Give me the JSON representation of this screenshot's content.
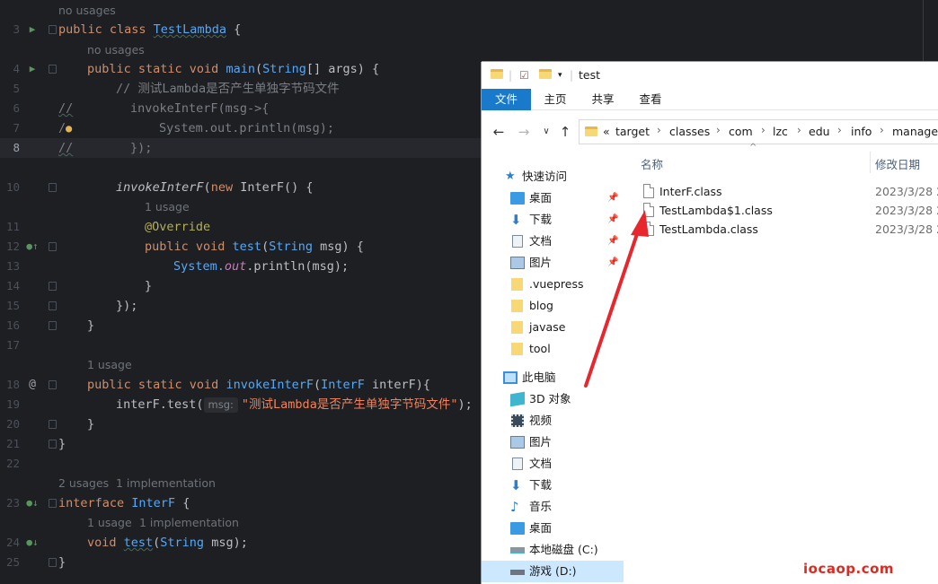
{
  "editor": {
    "usage_hints": {
      "class_usages": "no usages",
      "main_usages": "no usages",
      "override_usages": "1 usage",
      "invoke_usages": "1 usage",
      "interf_usages": "2 usages",
      "interf_impl": "1 implementation",
      "test_usages": "1 usage",
      "test_impl": "1 implementation"
    },
    "line_numbers": [
      "3",
      "4",
      "5",
      "6",
      "7",
      "8",
      "10",
      "11",
      "12",
      "13",
      "14",
      "15",
      "16",
      "17",
      "18",
      "19",
      "20",
      "21",
      "22",
      "23",
      "24",
      "25"
    ],
    "code": {
      "l3_kw": "public class ",
      "l3_name": "TestLambda",
      "l3_rest": " {",
      "l4_kw": "public static void ",
      "l4_fn": "main",
      "l4_p1": "(",
      "l4_type": "String",
      "l4_rest": "[] args) {",
      "l5_comment": "// 测试Lambda是否产生单独字节码文件",
      "l6_slash": "//",
      "l6_code": "invokeInterF(msg->{",
      "l7_slash": "/",
      "l7_code": "System.out.println(msg);",
      "l8_slash": "//",
      "l8_code": "});",
      "l10_fn": "invokeInterF",
      "l10_p": "(",
      "l10_kw": "new ",
      "l10_type": "InterF",
      "l10_rest": "() {",
      "l11_ann": "@Override",
      "l12_kw": "public void ",
      "l12_fn": "test",
      "l12_p": "(",
      "l12_type": "String",
      "l12_rest": " msg) {",
      "l13_sys": "System.",
      "l13_out": "out",
      "l13_rest": ".println(msg);",
      "l14": "}",
      "l15": "});",
      "l16": "}",
      "l18_kw": "public static void ",
      "l18_fn": "invokeInterF",
      "l18_p": "(",
      "l18_type": "InterF",
      "l18_rest": " interF){",
      "l19_pre": "interF.test(",
      "l19_hint": "msg:",
      "l19_str": "\"测试Lambda是否产生单独字节码文件\"",
      "l19_rest": ");",
      "l20": "}",
      "l21": "}",
      "l23_kw": "interface ",
      "l23_type": "InterF",
      "l23_rest": " {",
      "l24_kw": "void ",
      "l24_fn": "test",
      "l24_p": "(",
      "l24_type": "String",
      "l24_rest": " msg);",
      "l25": "}"
    }
  },
  "explorer": {
    "title": "test",
    "ribbon_tabs": [
      "文件",
      "主页",
      "共享",
      "查看"
    ],
    "breadcrumbs": [
      "«",
      "target",
      "classes",
      "com",
      "lzc",
      "edu",
      "info",
      "manager"
    ],
    "nav": {
      "quick_access": "快速访问",
      "quick_items": [
        "桌面",
        "下载",
        "文档",
        "图片",
        ".vuepress",
        "blog",
        "javase",
        "tool"
      ],
      "this_pc": "此电脑",
      "pc_items": [
        "3D 对象",
        "视频",
        "图片",
        "文档",
        "下载",
        "音乐",
        "桌面",
        "本地磁盘 (C:)",
        "游戏 (D:)"
      ]
    },
    "columns": {
      "name": "名称",
      "modified": "修改日期"
    },
    "files": [
      {
        "name": "InterF.class",
        "date": "2023/3/28 2"
      },
      {
        "name": "TestLambda$1.class",
        "date": "2023/3/28 2"
      },
      {
        "name": "TestLambda.class",
        "date": "2023/3/28 2"
      }
    ],
    "accent_color": "#1979ca"
  },
  "watermark": "iocaop.com"
}
